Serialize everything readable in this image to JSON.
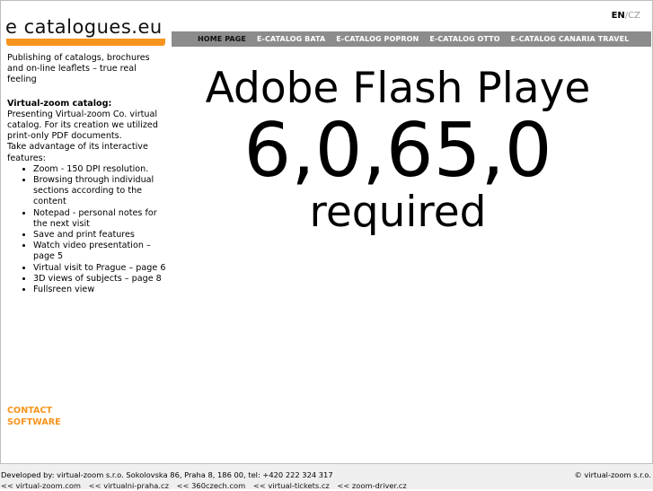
{
  "logo": {
    "text": "e catalogues.eu"
  },
  "lang": {
    "en": "EN",
    "separator": "/",
    "cz": "CZ"
  },
  "nav": [
    {
      "label": "HOME PAGE"
    },
    {
      "label": "E-CATALOG BATA"
    },
    {
      "label": "E-CATALOG POPRON"
    },
    {
      "label": "E-CATALOG OTTO"
    },
    {
      "label": "E-CATALOG CANARIA TRAVEL"
    }
  ],
  "intro": {
    "tagline": "Publishing of catalogs, brochures and on-line leaflets – true real feeling",
    "title": "Virtual-zoom catalog:",
    "desc": "Presenting Virtual-zoom Co. virtual catalog. For its creation we utilized print-only PDF documents.",
    "lead": "Take advantage of its interactive features:",
    "features": [
      "Zoom - 150 DPI resolution.",
      "Browsing through individual sections according to the content",
      "Notepad - personal notes for the next visit",
      "Save and print features",
      "Watch video presentation – page 5",
      "Virtual visit to Prague – page 6",
      "3D views of subjects – page 8",
      "Fullsreen view"
    ]
  },
  "links": {
    "contact": "CONTACT",
    "software": "SOFTWARE"
  },
  "flash": {
    "line1": "Adobe Flash Playe",
    "line2": "6,0,65,0",
    "line3": "required"
  },
  "footer": {
    "developer": "Developed by: virtual-zoom s.r.o. Sokolovska 86, Praha 8, 186 00, tel: +420 222 324 317",
    "copyright": "© virtual-zoom s.r.o.",
    "links": [
      "<< virtual-zoom.com",
      "<< virtualni-praha.cz",
      "<< 360czech.com",
      "<< virtual-tickets.cz",
      "<< zoom-driver.cz"
    ]
  },
  "colors": {
    "accent": "#f7941d",
    "nav_bg": "#8c8c8c",
    "footer_bg": "#efefef"
  }
}
